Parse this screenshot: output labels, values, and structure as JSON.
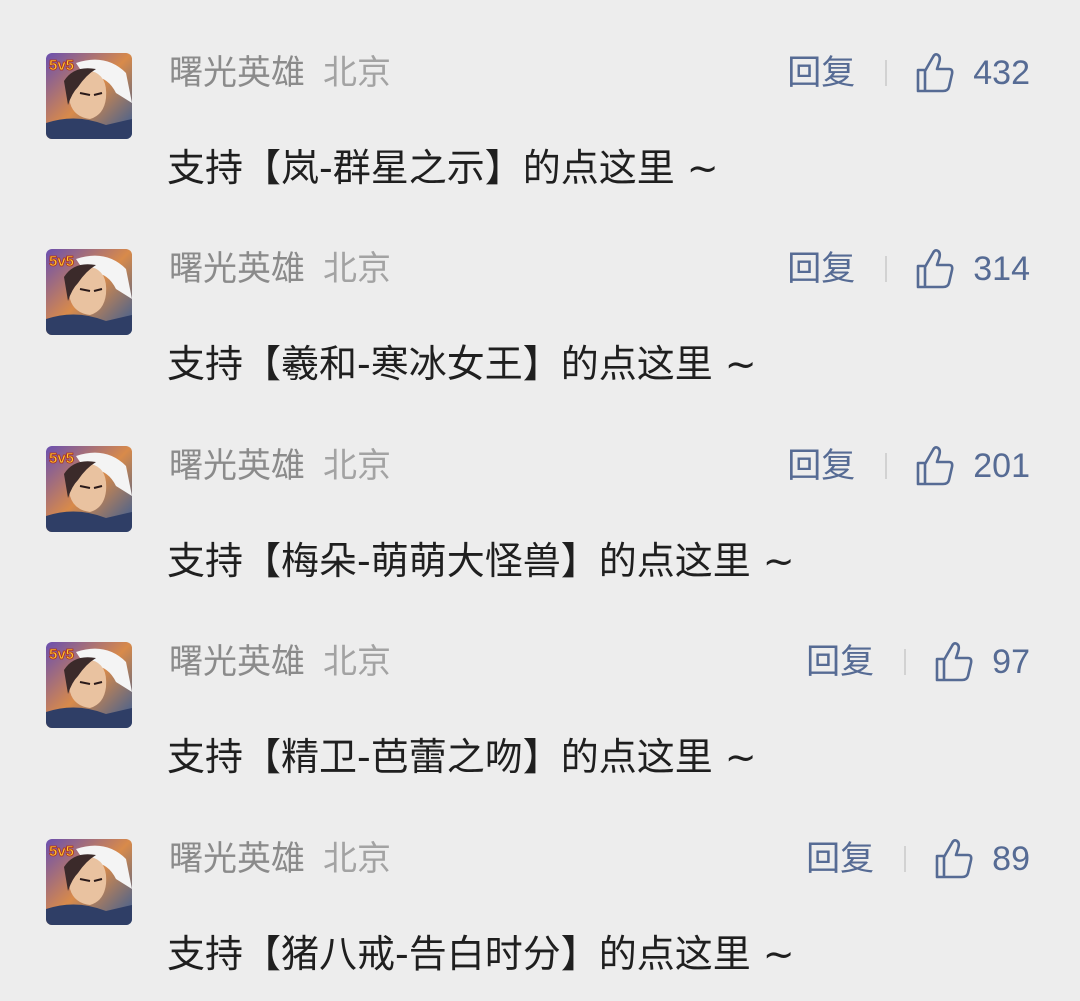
{
  "comments": [
    {
      "author": "曙光英雄",
      "location": "北京",
      "reply_label": "回复",
      "likes": "432",
      "content": "支持【岚-群星之示】的点这里 ~"
    },
    {
      "author": "曙光英雄",
      "location": "北京",
      "reply_label": "回复",
      "likes": "314",
      "content": "支持【羲和-寒冰女王】的点这里 ~"
    },
    {
      "author": "曙光英雄",
      "location": "北京",
      "reply_label": "回复",
      "likes": "201",
      "content": "支持【梅朵-萌萌大怪兽】的点这里 ~"
    },
    {
      "author": "曙光英雄",
      "location": "北京",
      "reply_label": "回复",
      "likes": "97",
      "content": "支持【精卫-芭蕾之吻】的点这里 ~"
    },
    {
      "author": "曙光英雄",
      "location": "北京",
      "reply_label": "回复",
      "likes": "89",
      "content": "支持【猪八戒-告白时分】的点这里 ~"
    }
  ],
  "avatar_badge": "5v5",
  "icons": {
    "like": "thumbs-up-icon",
    "avatar": "game-hero-avatar"
  },
  "colors": {
    "background": "#ededed",
    "link": "#566b94",
    "author": "#8b8b8b",
    "text": "#1f1f1f"
  }
}
